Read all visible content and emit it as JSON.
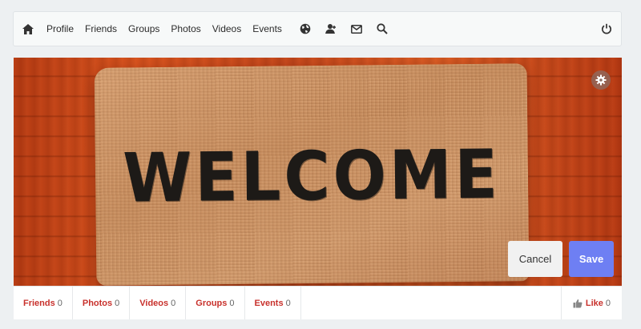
{
  "nav": {
    "links": [
      "Profile",
      "Friends",
      "Groups",
      "Photos",
      "Videos",
      "Events"
    ],
    "icons": [
      "home-icon",
      "globe-icon",
      "friend-requests-icon",
      "mail-icon",
      "search-icon",
      "power-icon"
    ]
  },
  "cover": {
    "mat_text": "WELCOME",
    "gear_icon": "gear-icon",
    "cancel_label": "Cancel",
    "save_label": "Save",
    "save_color": "#6e7ff3"
  },
  "stats": [
    {
      "label": "Friends",
      "count": "0"
    },
    {
      "label": "Photos",
      "count": "0"
    },
    {
      "label": "Videos",
      "count": "0"
    },
    {
      "label": "Groups",
      "count": "0"
    },
    {
      "label": "Events",
      "count": "0"
    }
  ],
  "like": {
    "label": "Like",
    "count": "0",
    "icon": "thumbs-up-icon"
  },
  "colors": {
    "stat_label": "#c8312c",
    "accent": "#6e7ff3"
  }
}
